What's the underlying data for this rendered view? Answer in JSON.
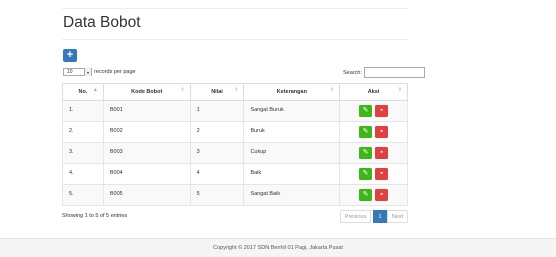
{
  "page": {
    "title": "Data Bobot"
  },
  "toolbar": {
    "add_icon": "plus-icon",
    "add_glyph": "+"
  },
  "length": {
    "value": "10",
    "label": "records per page",
    "arrow": "▾"
  },
  "search": {
    "label": "Search:",
    "value": ""
  },
  "table": {
    "headers": {
      "no": "No.",
      "kode": "Kode Bobot",
      "nilai": "Nilai",
      "keterangan": "Keterangan",
      "aksi": "Aksi"
    },
    "rows": [
      {
        "no": "1.",
        "kode": "B001",
        "nilai": "1",
        "keterangan": "Sangat Buruk"
      },
      {
        "no": "2.",
        "kode": "B002",
        "nilai": "2",
        "keterangan": "Buruk"
      },
      {
        "no": "3.",
        "kode": "B003",
        "nilai": "3",
        "keterangan": "Cukup"
      },
      {
        "no": "4.",
        "kode": "B004",
        "nilai": "4",
        "keterangan": "Baik"
      },
      {
        "no": "5.",
        "kode": "B005",
        "nilai": "5",
        "keterangan": "Sangat Baik"
      }
    ],
    "edit_icon": "pencil-icon",
    "delete_icon": "trash-icon"
  },
  "info": "Showing 1 to 5 of 5 entries",
  "pagination": {
    "previous": "Previous",
    "current": "1",
    "next": "Next"
  },
  "footer": {
    "copyright": "Copyright © 2017 SDN Benhil 01 Pagi, Jakarta Pusat"
  },
  "colors": {
    "primary": "#337ab7",
    "edit": "#3fb618",
    "delete": "#e04040"
  }
}
